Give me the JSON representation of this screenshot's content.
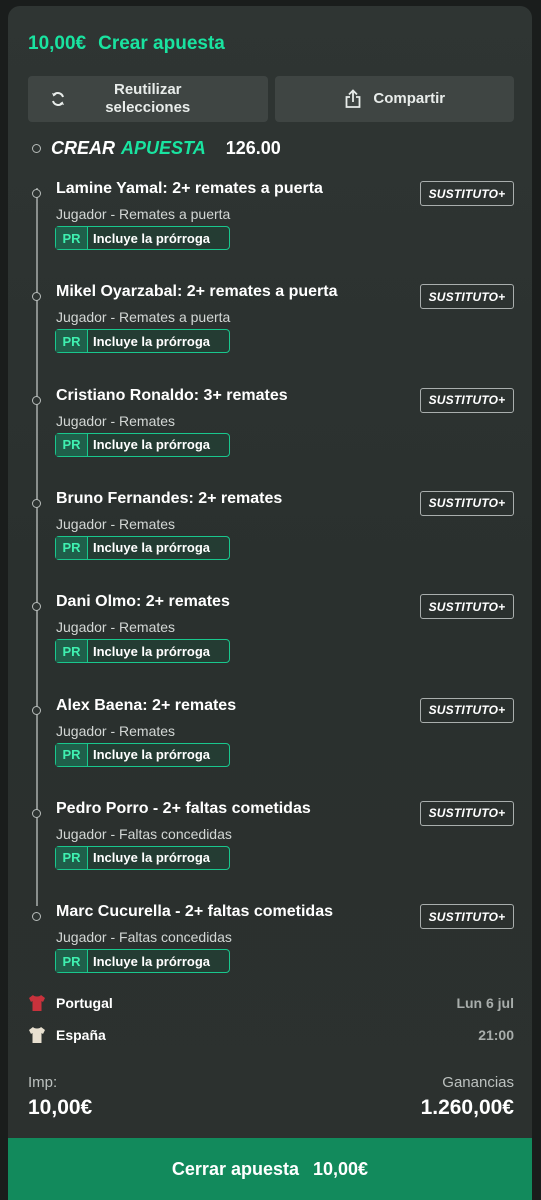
{
  "header": {
    "amount": "10,00€",
    "title": "Crear apuesta"
  },
  "toolbar": {
    "reuse_label_line1": "Reutilizar",
    "reuse_label_line2": "selecciones",
    "share_label": "Compartir"
  },
  "builder": {
    "word1": "CREAR",
    "word2": "APUESTA",
    "odds": "126.00"
  },
  "selections": [
    {
      "title": "Lamine Yamal: 2+ remates a puerta",
      "market": "Jugador - Remates a puerta",
      "pr": "PR",
      "badge": "Incluye la prórroga",
      "sub_btn": "SUSTITUTO+"
    },
    {
      "title": "Mikel Oyarzabal: 2+ remates a puerta",
      "market": "Jugador - Remates a puerta",
      "pr": "PR",
      "badge": "Incluye la prórroga",
      "sub_btn": "SUSTITUTO+"
    },
    {
      "title": "Cristiano Ronaldo: 3+ remates",
      "market": "Jugador - Remates",
      "pr": "PR",
      "badge": "Incluye la prórroga",
      "sub_btn": "SUSTITUTO+"
    },
    {
      "title": "Bruno Fernandes: 2+ remates",
      "market": "Jugador - Remates",
      "pr": "PR",
      "badge": "Incluye la prórroga",
      "sub_btn": "SUSTITUTO+"
    },
    {
      "title": "Dani Olmo: 2+ remates",
      "market": "Jugador - Remates",
      "pr": "PR",
      "badge": "Incluye la prórroga",
      "sub_btn": "SUSTITUTO+"
    },
    {
      "title": "Alex Baena: 2+ remates",
      "market": "Jugador - Remates",
      "pr": "PR",
      "badge": "Incluye la prórroga",
      "sub_btn": "SUSTITUTO+"
    },
    {
      "title": "Pedro Porro - 2+ faltas cometidas",
      "market": "Jugador - Faltas concedidas",
      "pr": "PR",
      "badge": "Incluye la prórroga",
      "sub_btn": "SUSTITUTO+"
    },
    {
      "title": "Marc Cucurella - 2+ faltas cometidas",
      "market": "Jugador - Faltas concedidas",
      "pr": "PR",
      "badge": "Incluye la prórroga",
      "sub_btn": "SUSTITUTO+"
    }
  ],
  "match": {
    "home": {
      "name": "Portugal",
      "shirt_color": "#c8323c",
      "info": "Lun 6 jul"
    },
    "away": {
      "name": "España",
      "shirt_color": "#e8e0d0",
      "info": "21:00"
    }
  },
  "stake": {
    "label": "Imp:",
    "value": "10,00€"
  },
  "returns": {
    "label": "Ganancias",
    "value": "1.260,00€"
  },
  "cta": {
    "label": "Cerrar apuesta",
    "amount": "10,00€"
  },
  "colors": {
    "accent": "#19e3a0",
    "cta": "#128a5c",
    "card": "#2f3533"
  }
}
